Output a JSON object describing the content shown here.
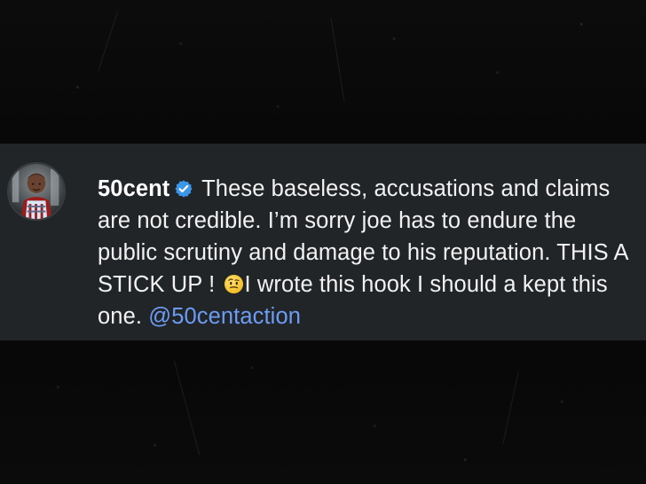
{
  "post": {
    "username": "50cent",
    "verified_icon": "verified-badge-icon",
    "text_part1": " These baseless, accusations and claims are not credible. I’m sorry joe has to endure the public scrutiny and damage to his reputation. THIS A STICK UP ! ",
    "emoji_icon": "raised-eyebrow-emoji-icon",
    "text_part2": "I wrote this hook I should a kept this one. ",
    "mention": "@50centaction"
  },
  "colors": {
    "background": "#070707",
    "comment_band": "#222527",
    "text": "#f2f2f2",
    "mention": "#6d9cf5",
    "verified": "#3b97ea"
  }
}
